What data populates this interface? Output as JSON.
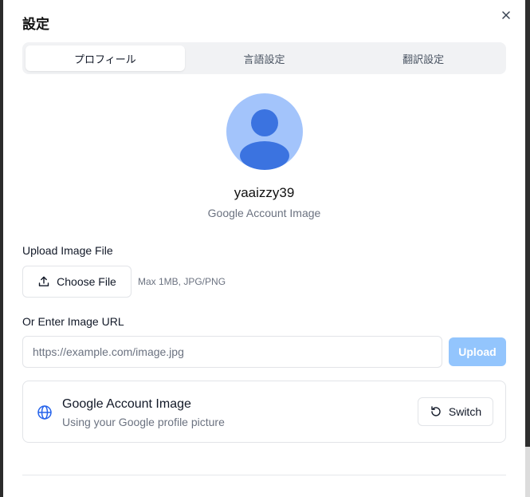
{
  "dialog": {
    "title": "設定"
  },
  "tabs": [
    {
      "label": "プロフィール",
      "active": true
    },
    {
      "label": "言語設定",
      "active": false
    },
    {
      "label": "翻訳設定",
      "active": false
    }
  ],
  "profile": {
    "username": "yaaizzy39",
    "avatar_caption": "Google Account Image",
    "avatar_icon": "user-avatar-icon"
  },
  "upload": {
    "label": "Upload Image File",
    "choose_button": "Choose File",
    "hint": "Max 1MB, JPG/PNG"
  },
  "url": {
    "label": "Or Enter Image URL",
    "placeholder": "https://example.com/image.jpg",
    "value": "",
    "upload_button": "Upload"
  },
  "google_card": {
    "title": "Google Account Image",
    "subtitle": "Using your Google profile picture",
    "switch_button": "Switch"
  },
  "colors": {
    "accent": "#2563eb",
    "avatar_bg": "#a3c4fb",
    "avatar_fg": "#3b73e0",
    "upload_disabled": "#93c5fd"
  }
}
